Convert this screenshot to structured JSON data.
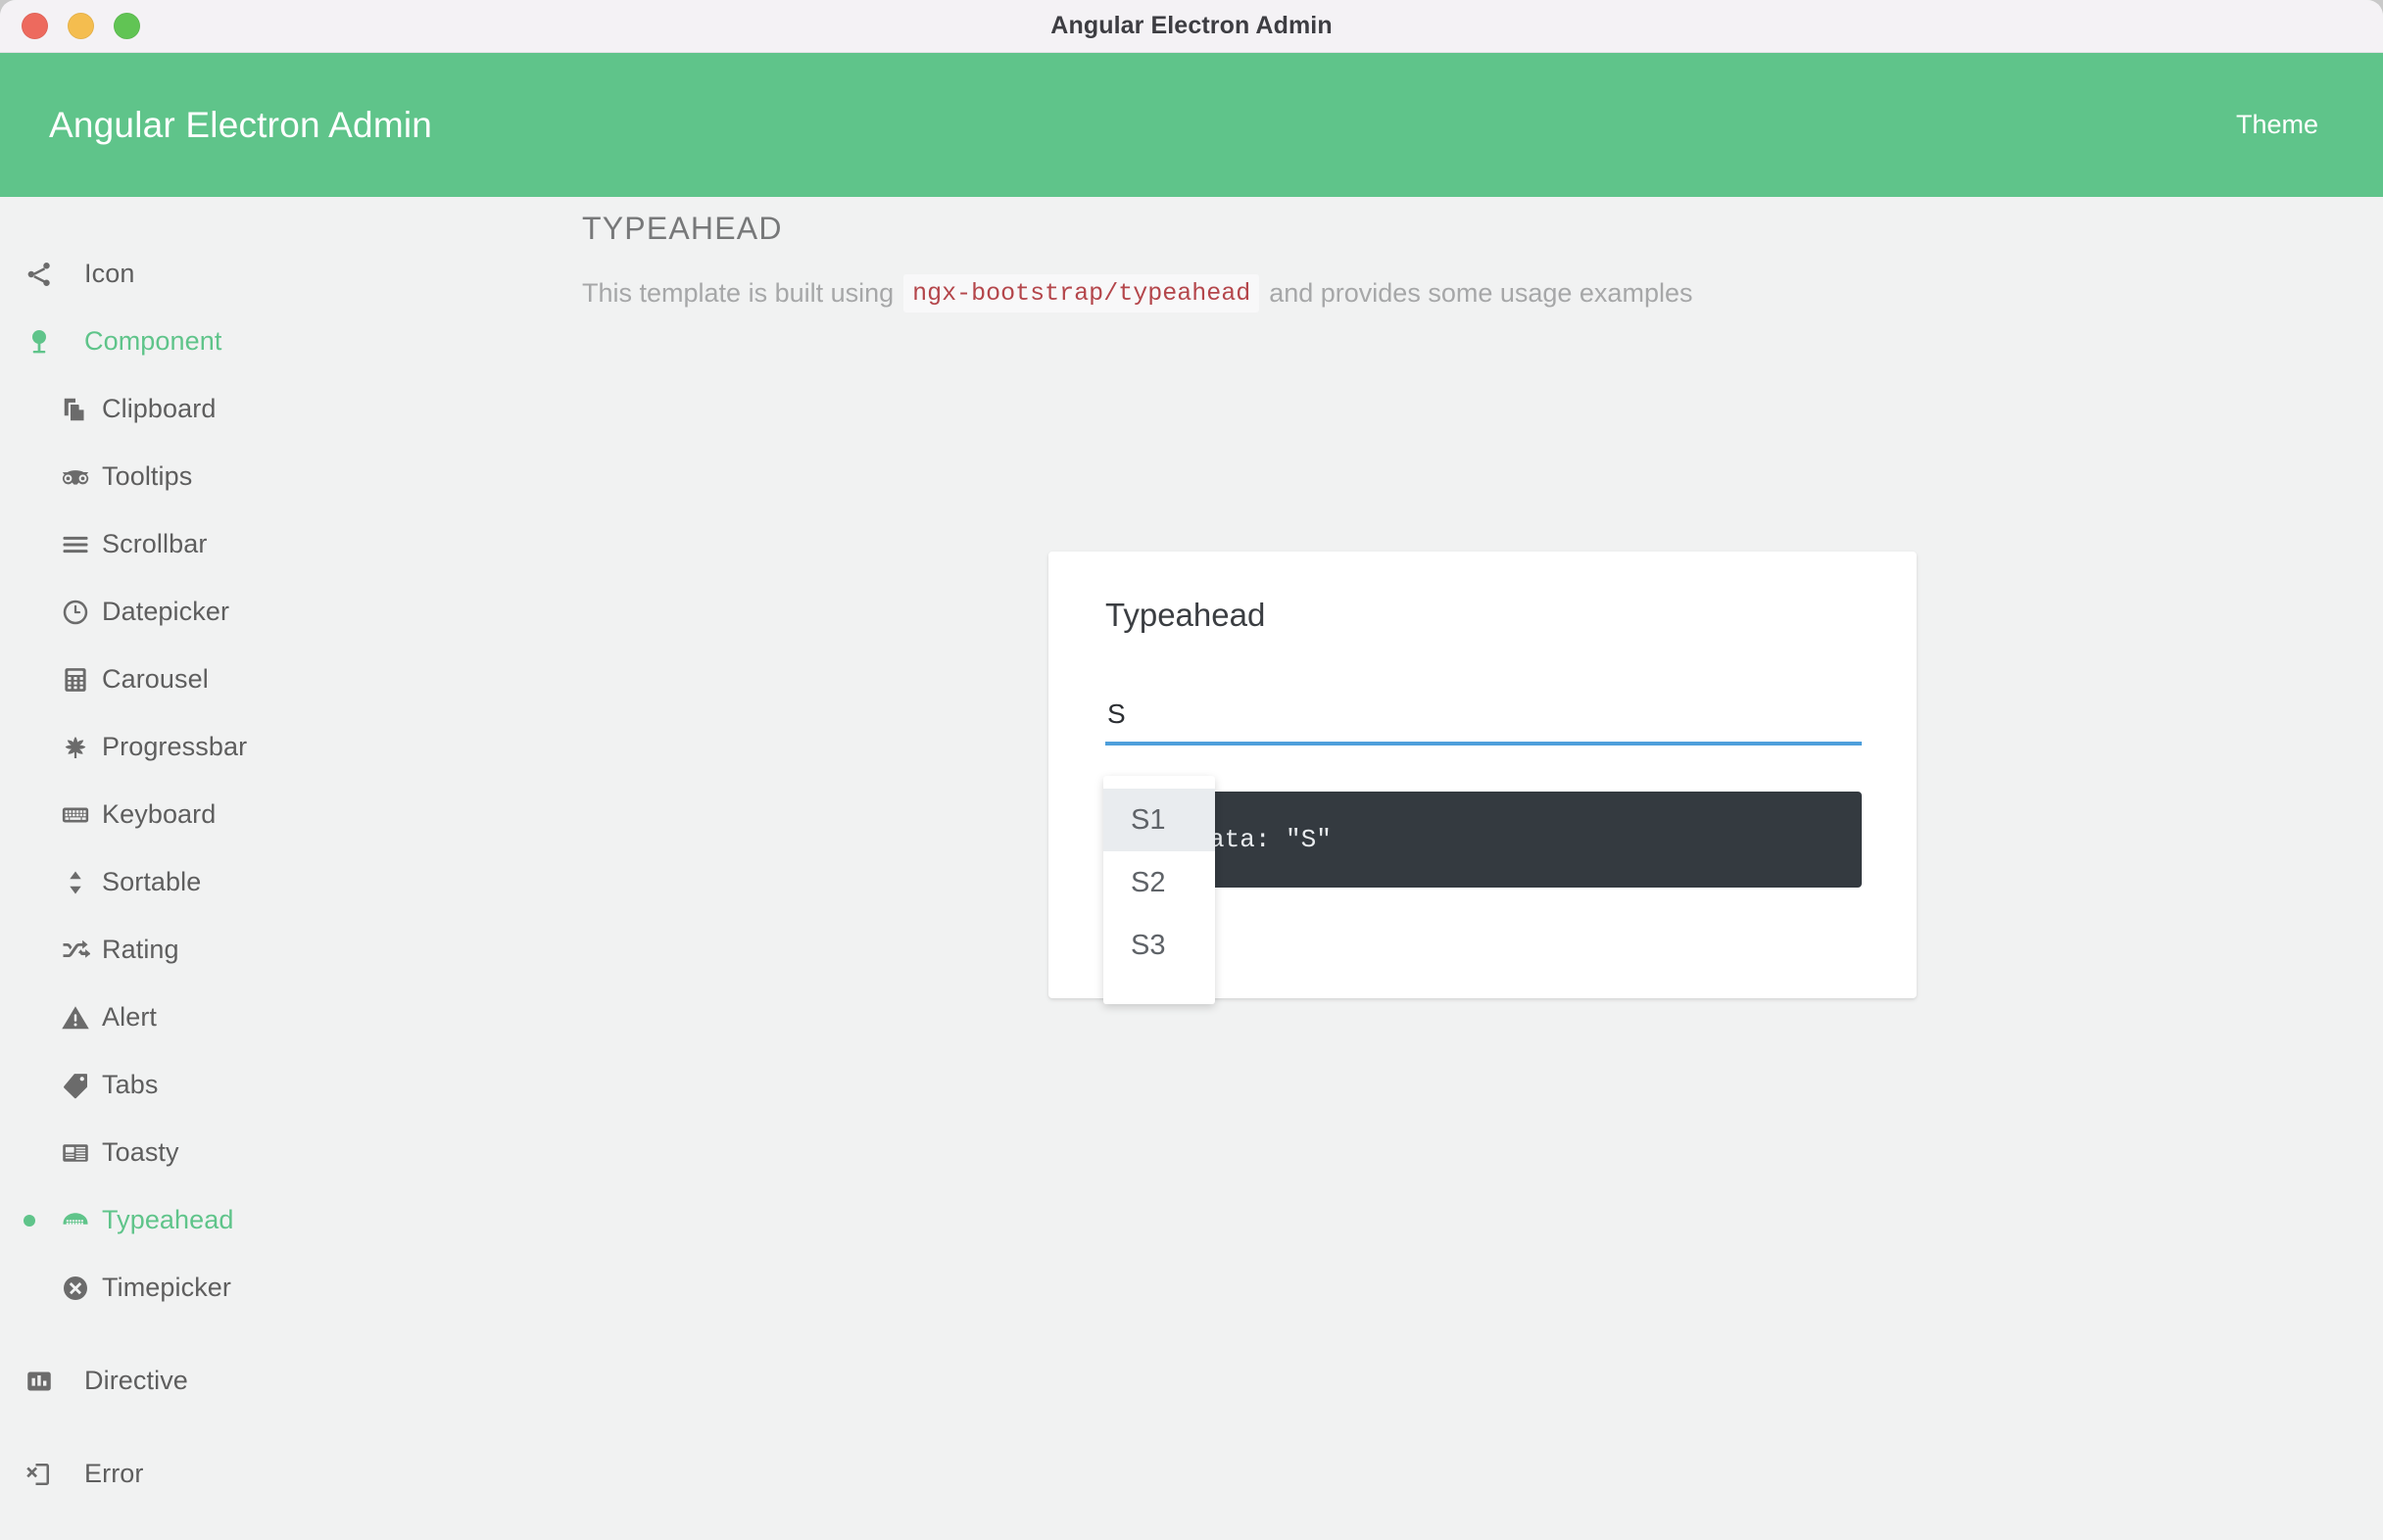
{
  "window": {
    "title": "Angular Electron Admin",
    "traffic_lights": [
      {
        "name": "close",
        "color": "#ed6a5e"
      },
      {
        "name": "minimize",
        "color": "#f4bd4f"
      },
      {
        "name": "maximize",
        "color": "#61c454"
      }
    ]
  },
  "header": {
    "brand": "Angular Electron Admin",
    "theme_label": "Theme",
    "background": "#5fc48a"
  },
  "sidebar": {
    "items": [
      {
        "label": "Icon",
        "icon": "share-icon",
        "level": "top",
        "active": false,
        "bullet": false
      },
      {
        "label": "Component",
        "icon": "tree-icon",
        "level": "top",
        "active": true,
        "bullet": false
      },
      {
        "label": "Clipboard",
        "icon": "clipboard-icon",
        "level": "sub",
        "active": false,
        "bullet": false
      },
      {
        "label": "Tooltips",
        "icon": "tripadvisor-icon",
        "level": "sub",
        "active": false,
        "bullet": false
      },
      {
        "label": "Scrollbar",
        "icon": "bars-icon",
        "level": "sub",
        "active": false,
        "bullet": false
      },
      {
        "label": "Datepicker",
        "icon": "clock-icon",
        "level": "sub",
        "active": false,
        "bullet": false
      },
      {
        "label": "Carousel",
        "icon": "calculator-icon",
        "level": "sub",
        "active": false,
        "bullet": false
      },
      {
        "label": "Progressbar",
        "icon": "leaf-icon",
        "level": "sub",
        "active": false,
        "bullet": false
      },
      {
        "label": "Keyboard",
        "icon": "keyboard-icon",
        "level": "sub",
        "active": false,
        "bullet": false
      },
      {
        "label": "Sortable",
        "icon": "sort-icon",
        "level": "sub",
        "active": false,
        "bullet": false
      },
      {
        "label": "Rating",
        "icon": "shuffle-icon",
        "level": "sub",
        "active": false,
        "bullet": false
      },
      {
        "label": "Alert",
        "icon": "warning-icon",
        "level": "sub",
        "active": false,
        "bullet": false
      },
      {
        "label": "Tabs",
        "icon": "tag-icon",
        "level": "sub",
        "active": false,
        "bullet": false
      },
      {
        "label": "Toasty",
        "icon": "newspaper-icon",
        "level": "sub",
        "active": false,
        "bullet": false
      },
      {
        "label": "Typeahead",
        "icon": "keyboard-alt-icon",
        "level": "sub",
        "active": true,
        "bullet": true
      },
      {
        "label": "Timepicker",
        "icon": "times-circle-icon",
        "level": "sub",
        "active": false,
        "bullet": false
      },
      {
        "label": "Directive",
        "icon": "chart-bar-icon",
        "level": "top",
        "active": false,
        "bullet": false
      },
      {
        "label": "Error",
        "icon": "mobile-x-icon",
        "level": "top",
        "active": false,
        "bullet": false
      }
    ]
  },
  "main": {
    "page_title": "TYPEAHEAD",
    "subtitle_before": "This template is built using",
    "subtitle_code": "ngx-bootstrap/typeahead",
    "subtitle_after": "and provides some usage examples",
    "card": {
      "title": "Typeahead",
      "input_value": "S",
      "input_placeholder": "",
      "output_text": "ted data: \"S\"",
      "underline_color": "#4e9fdb"
    },
    "dropdown": {
      "options": [
        {
          "label": "S1",
          "active": true
        },
        {
          "label": "S2",
          "active": false
        },
        {
          "label": "S3",
          "active": false
        }
      ]
    }
  }
}
